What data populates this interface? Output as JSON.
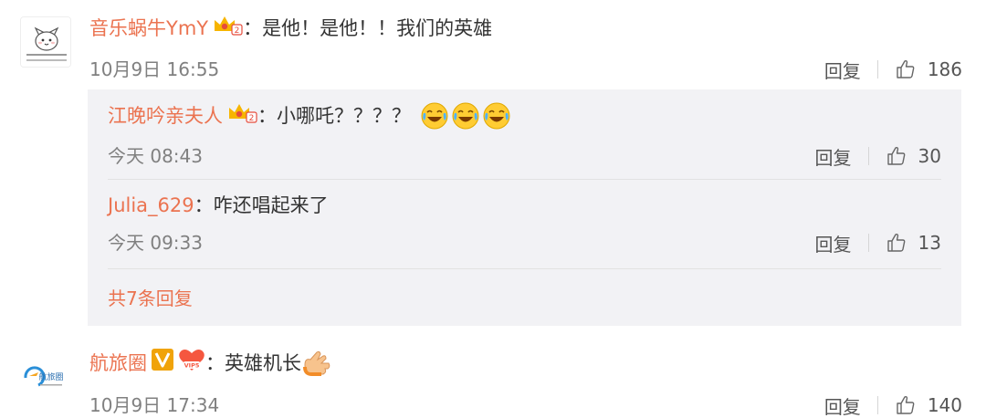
{
  "comments": [
    {
      "username": "音乐蜗牛YmY",
      "text": "：是他！是他！！我们的英雄",
      "time": "10月9日 16:55",
      "reply_label": "回复",
      "likes": "186",
      "avatar_icon": "cat-cartoon-avatar",
      "badges": [
        "crown-vip-2-icon"
      ],
      "replies": [
        {
          "username": "江晚吟亲夫人",
          "text": "：小哪吒？？？？",
          "emojis": [
            "laugh-cry-emoji",
            "laugh-cry-emoji",
            "laugh-cry-emoji"
          ],
          "time": "今天 08:43",
          "reply_label": "回复",
          "likes": "30",
          "badges": [
            "crown-vip-2-icon"
          ]
        },
        {
          "username": "Julia_629",
          "text": "：咋还唱起来了",
          "time": "今天 09:33",
          "reply_label": "回复",
          "likes": "13"
        }
      ],
      "more_replies": "共7条回复"
    },
    {
      "username": "航旅圈",
      "text": "：英雄机长",
      "emojis": [
        "praying-hands-emoji"
      ],
      "time": "10月9日 17:34",
      "reply_label": "回复",
      "likes": "140",
      "avatar_icon": "airline-logo-avatar",
      "avatar_logo_text": "航旅圈",
      "badges": [
        "verified-v-icon",
        "vip5-heart-icon"
      ]
    }
  ],
  "colors": {
    "username": "#eb7350",
    "text": "#333333",
    "meta": "#808080",
    "reply_box_bg": "#f2f2f5",
    "verified": "#f0a30a",
    "vip_heart": "#f5573f"
  }
}
